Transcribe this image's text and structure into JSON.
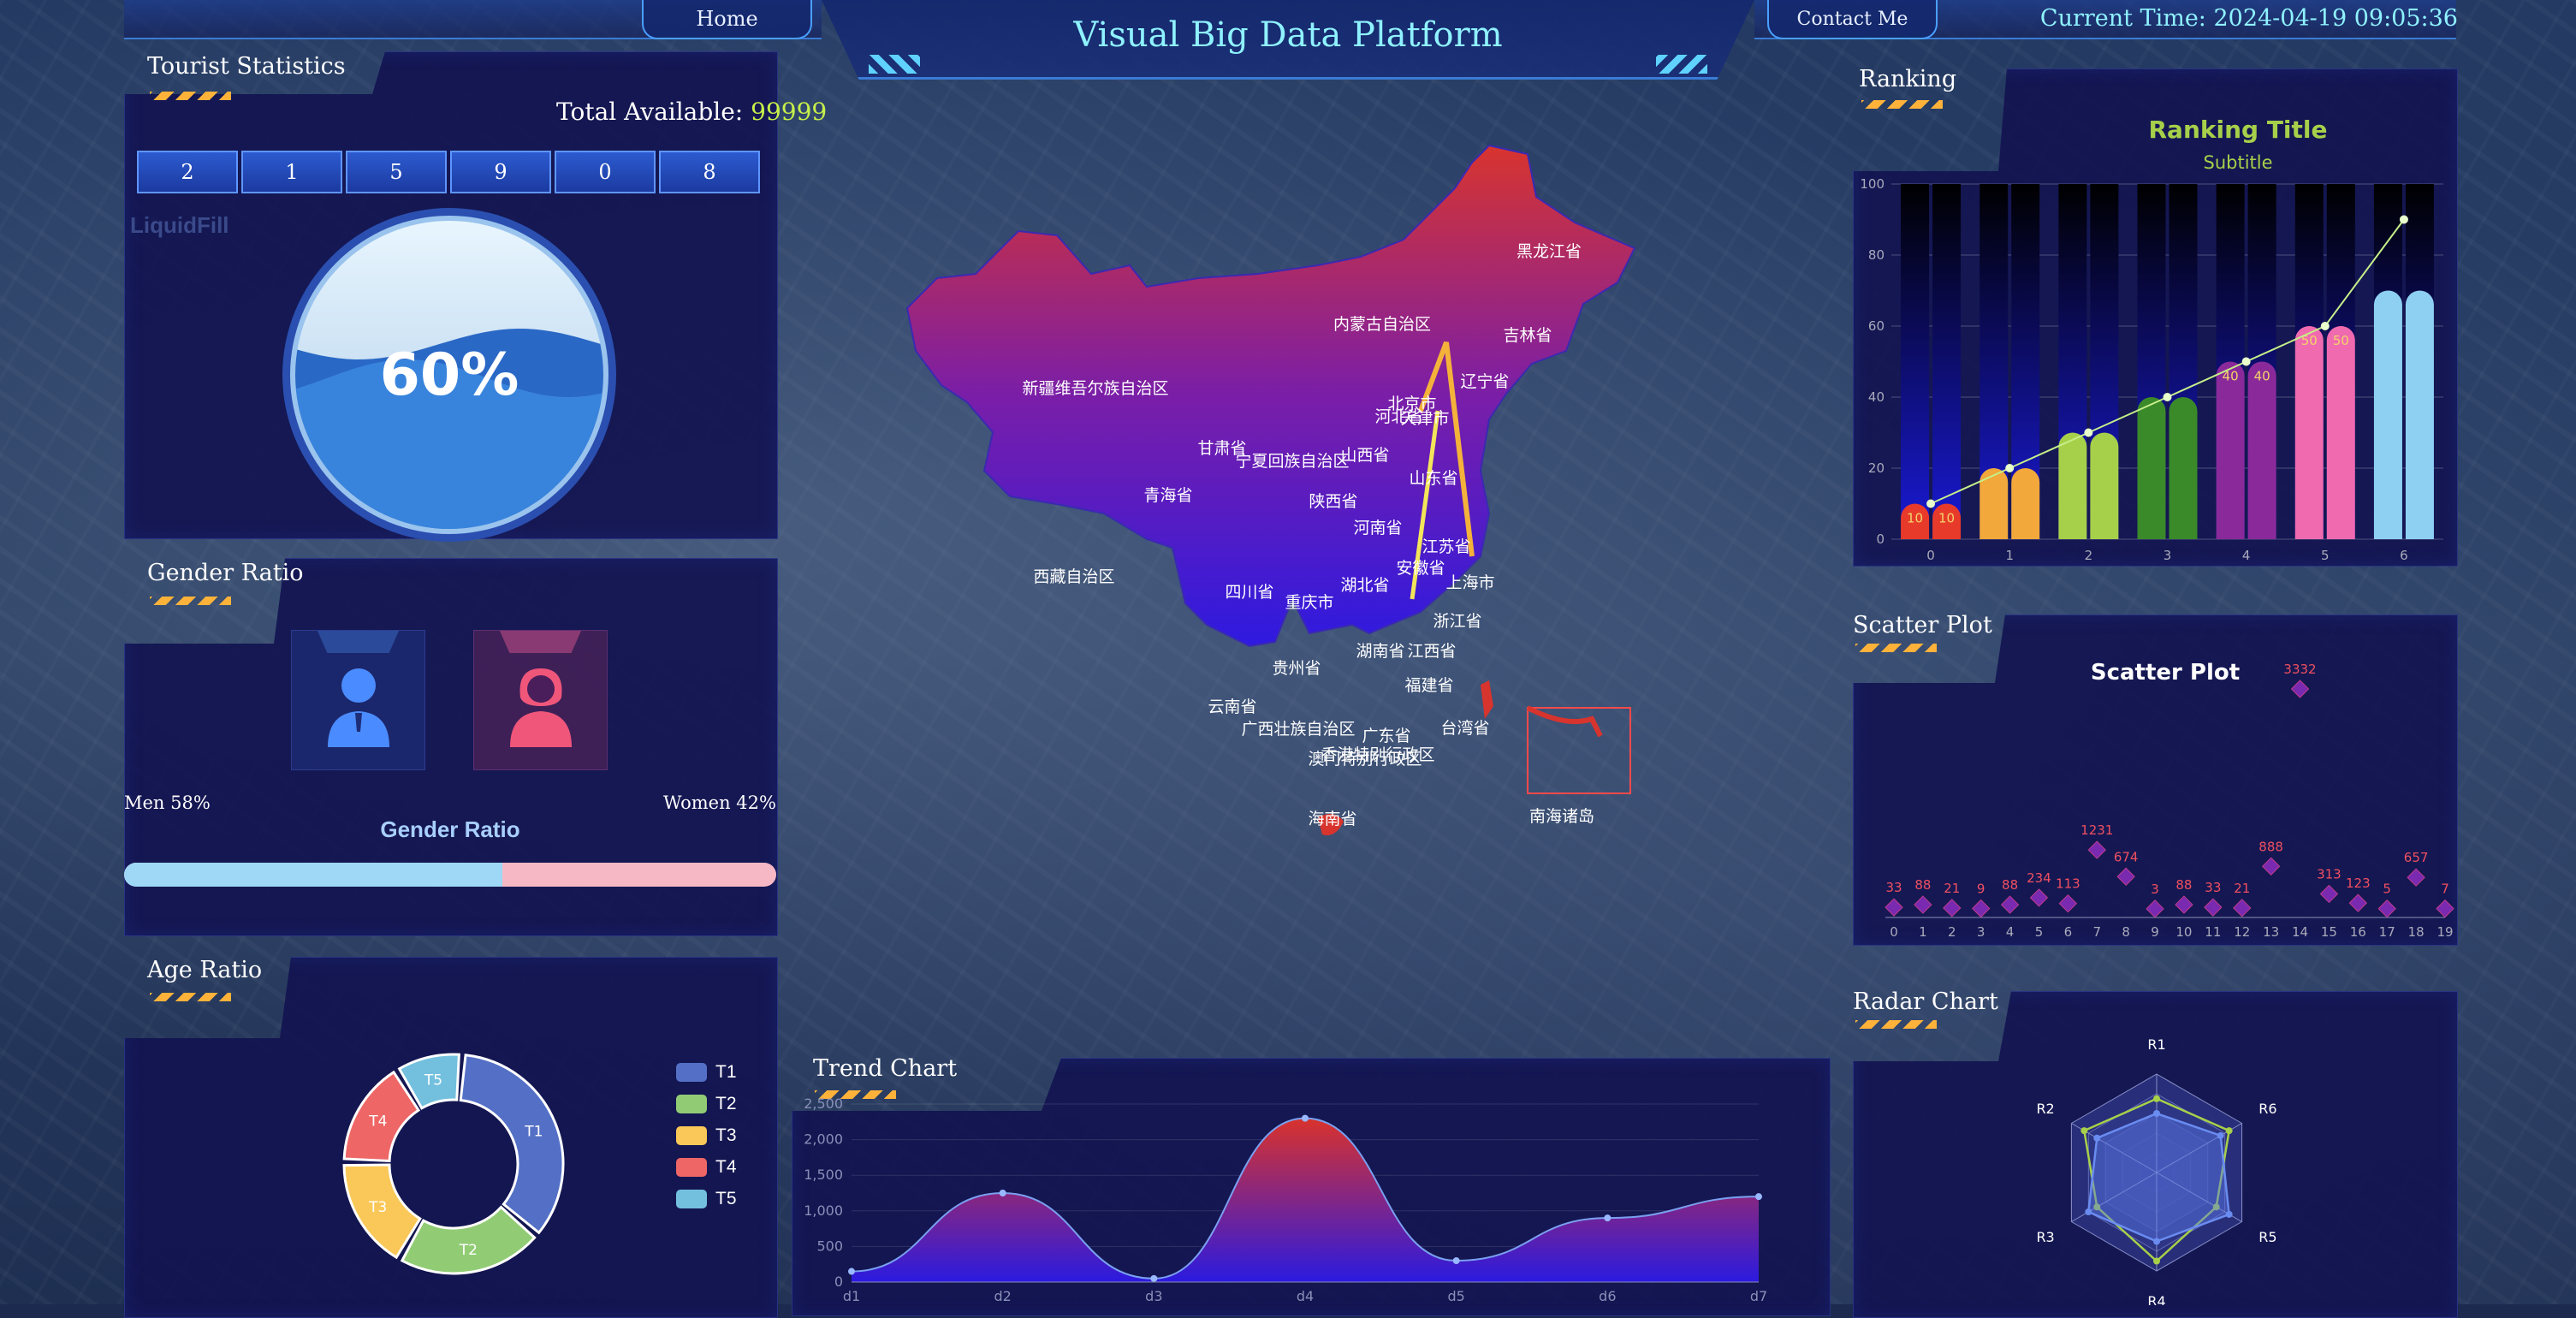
{
  "header": {
    "home_label": "Home",
    "title": "Visual Big Data Platform",
    "contact_label": "Contact Me",
    "current_time": "Current Time: 2024-04-19 09:05:36"
  },
  "tourist": {
    "title": "Tourist Statistics",
    "total_label": "Total Available: ",
    "total_value": "99999",
    "digits": [
      "2",
      "1",
      "5",
      "9",
      "0",
      "8"
    ],
    "liquid_label": "LiquidFill",
    "liquid_value": "60%",
    "liquid_level": 0.6
  },
  "gender": {
    "title": "Gender Ratio",
    "men_label": "Men 58%",
    "women_label": "Women 42%",
    "chart_title": "Gender Ratio",
    "men_fraction": 0.58
  },
  "age": {
    "title": "Age Ratio",
    "legend": [
      "T1",
      "T2",
      "T3",
      "T4",
      "T5"
    ]
  },
  "trend": {
    "title": "Trend Chart"
  },
  "ranking": {
    "title": "Ranking",
    "chart_title": "Ranking Title",
    "chart_subtitle": "Subtitle"
  },
  "scatter": {
    "title": "Scatter Plot",
    "chart_title": "Scatter Plot"
  },
  "radar": {
    "title": "Radar Chart"
  },
  "map": {
    "regions": [
      "新疆维吾尔族自治区",
      "西藏自治区",
      "青海省",
      "甘肃省",
      "宁夏回族自治区",
      "内蒙古自治区",
      "黑龙江省",
      "吉林省",
      "辽宁省",
      "北京市",
      "天津市",
      "河北省",
      "山西省",
      "陕西省",
      "山东省",
      "河南省",
      "江苏省",
      "安徽省",
      "上海市",
      "湖北省",
      "重庆市",
      "四川省",
      "浙江省",
      "湖南省",
      "江西省",
      "贵州省",
      "福建省",
      "云南省",
      "广西壮族自治区",
      "广东省",
      "台湾省",
      "香港特别行政区",
      "澳门特别行政区",
      "海南省",
      "南海诸岛"
    ]
  },
  "colors": {
    "accent": "#8ff2ff",
    "highlight": "#c6ef4a",
    "panel": "#14145a"
  },
  "chart_data": [
    {
      "type": "bar",
      "name": "ranking",
      "categories": [
        "0",
        "1",
        "2",
        "3",
        "4",
        "5",
        "6"
      ],
      "series": [
        {
          "values": [
            10,
            20,
            30,
            40,
            50,
            60,
            70
          ]
        },
        {
          "values": [
            10,
            20,
            30,
            40,
            50,
            60,
            70
          ]
        }
      ],
      "line": [
        10,
        20,
        30,
        40,
        50,
        60,
        90
      ],
      "bar_labels": [
        "10",
        "10",
        "",
        "",
        "",
        "",
        "",
        "",
        "40",
        "40",
        "50",
        "50",
        "",
        "",
        "70",
        "70"
      ],
      "colors": [
        "#e83a2a",
        "#f2a83a",
        "#a7d04a",
        "#3a8a2a",
        "#8a2a9a",
        "#f06ab0",
        "#8ed0f2"
      ],
      "title": "Ranking Title",
      "subtitle": "Subtitle",
      "ylim": [
        0,
        100
      ],
      "yticks": [
        "100",
        "80",
        "60",
        "40",
        "20",
        "0"
      ]
    },
    {
      "type": "scatter",
      "name": "scatter",
      "title": "Scatter Plot",
      "x": [
        0,
        1,
        2,
        3,
        4,
        5,
        6,
        7,
        8,
        9,
        10,
        11,
        12,
        13,
        14,
        15,
        16,
        17,
        18,
        19
      ],
      "values": [
        33,
        88,
        21,
        9,
        88,
        234,
        113,
        1231,
        674,
        3,
        88,
        33,
        21,
        888,
        0,
        313,
        123,
        5,
        657,
        7
      ],
      "value_labels": [
        "33",
        "88",
        "21",
        "9",
        "88",
        "234",
        "113",
        "1231",
        "674",
        "3",
        "88",
        "33",
        "21",
        "888",
        "",
        "313",
        "123",
        "5",
        "657",
        "7"
      ],
      "peak_label": "3332",
      "peak_value": 3332,
      "peak_x": 14
    },
    {
      "type": "pie",
      "name": "age",
      "categories": [
        "T1",
        "T2",
        "T3",
        "T4",
        "T5"
      ],
      "values": [
        35,
        22,
        17,
        16,
        10
      ],
      "colors": [
        "#5470c6",
        "#91cc75",
        "#fac858",
        "#ee6666",
        "#73c0de"
      ]
    },
    {
      "type": "area",
      "name": "trend",
      "categories": [
        "d1",
        "d2",
        "d3",
        "d4",
        "d5",
        "d6",
        "d7"
      ],
      "values": [
        150,
        1250,
        50,
        2300,
        300,
        900,
        1200
      ],
      "ylim": [
        0,
        2500
      ],
      "yticks": [
        "2,500",
        "2,000",
        "1,500",
        "1,000",
        "500",
        "0"
      ]
    },
    {
      "type": "radar",
      "name": "radar",
      "indicators": [
        "R1",
        "R6",
        "R5",
        "R4",
        "R3",
        "R2"
      ],
      "series": [
        {
          "values": [
            0.75,
            0.85,
            0.7,
            0.9,
            0.7,
            0.85
          ]
        },
        {
          "values": [
            0.6,
            0.75,
            0.85,
            0.7,
            0.8,
            0.7
          ]
        }
      ]
    }
  ]
}
